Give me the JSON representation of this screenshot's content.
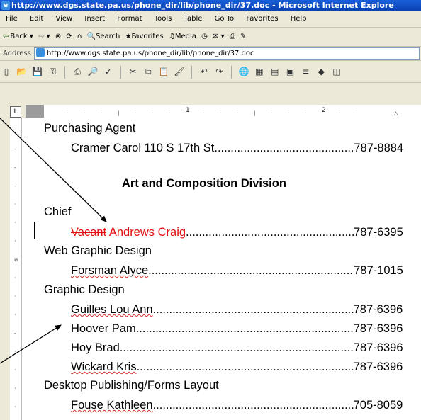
{
  "window": {
    "title": "http://www.dgs.state.pa.us/phone_dir/lib/phone_dir/37.doc - Microsoft Internet Explore"
  },
  "menu": [
    "File",
    "Edit",
    "View",
    "Insert",
    "Format",
    "Tools",
    "Table",
    "Go To",
    "Favorites",
    "Help"
  ],
  "toolbar": {
    "back": "Back",
    "search": "Search",
    "favorites": "Favorites",
    "media": "Media"
  },
  "address": {
    "label": "Address",
    "url": "http://www.dgs.state.pa.us/phone_dir/lib/phone_dir/37.doc"
  },
  "ruler": {
    "num1": "1",
    "num2": "2"
  },
  "document": {
    "purchasing_agent_title": "Purchasing Agent",
    "purchasing_agent_name": "Cramer Carol 110 S 17th St",
    "purchasing_agent_phone": "787-8884",
    "division_heading": "Art and Composition Division",
    "chief_title": "Chief",
    "chief_deleted": "Vacant",
    "chief_inserted": " Andrews Craig",
    "chief_phone": "787-6395",
    "web_title": "Web Graphic Design",
    "web_name": "Forsman Alyce",
    "web_phone": "787-1015",
    "graphic_title": "Graphic Design",
    "graphic_staff": [
      {
        "name": "Guilles Lou Ann",
        "phone": "787-6396"
      },
      {
        "name": "Hoover Pam",
        "phone": "787-6396"
      },
      {
        "name": "Hoy Brad",
        "phone": "787-6396"
      },
      {
        "name": "Wickard Kris",
        "phone": "787-6396"
      }
    ],
    "desktop_title": "Desktop Publishing/Forms Layout",
    "desktop_name": "Fouse Kathleen",
    "desktop_phone": "705-8059"
  }
}
